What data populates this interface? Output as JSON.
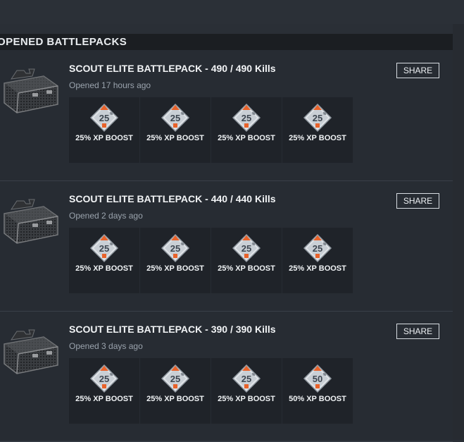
{
  "panel": {
    "title": "OPENED BATTLEPACKS"
  },
  "colors": {
    "background": "#2a2f36",
    "panel": "#272c33",
    "header_bar": "#1b1e22",
    "reward_tile": "#1f2329",
    "badge_orange": "#e8622a",
    "text_muted": "#9aa3ad"
  },
  "battlepacks": [
    {
      "icon": "battlepack-case-icon",
      "title": "SCOUT ELITE BATTLEPACK - 490 / 490 Kills",
      "opened": "Opened 17 hours ago",
      "share_label": "SHARE",
      "rewards": [
        {
          "icon": "xp-boost-icon",
          "badge_text": "25",
          "label": "25% XP BOOST"
        },
        {
          "icon": "xp-boost-icon",
          "badge_text": "25",
          "label": "25% XP BOOST"
        },
        {
          "icon": "xp-boost-icon",
          "badge_text": "25",
          "label": "25% XP BOOST"
        },
        {
          "icon": "xp-boost-icon",
          "badge_text": "25",
          "label": "25% XP BOOST"
        }
      ]
    },
    {
      "icon": "battlepack-case-icon",
      "title": "SCOUT ELITE BATTLEPACK - 440 / 440 Kills",
      "opened": "Opened 2 days ago",
      "share_label": "SHARE",
      "rewards": [
        {
          "icon": "xp-boost-icon",
          "badge_text": "25",
          "label": "25% XP BOOST"
        },
        {
          "icon": "xp-boost-icon",
          "badge_text": "25",
          "label": "25% XP BOOST"
        },
        {
          "icon": "xp-boost-icon",
          "badge_text": "25",
          "label": "25% XP BOOST"
        },
        {
          "icon": "xp-boost-icon",
          "badge_text": "25",
          "label": "25% XP BOOST"
        }
      ]
    },
    {
      "icon": "battlepack-case-icon",
      "title": "SCOUT ELITE BATTLEPACK - 390 / 390 Kills",
      "opened": "Opened 3 days ago",
      "share_label": "SHARE",
      "rewards": [
        {
          "icon": "xp-boost-icon",
          "badge_text": "25",
          "label": "25% XP BOOST"
        },
        {
          "icon": "xp-boost-icon",
          "badge_text": "25",
          "label": "25% XP BOOST"
        },
        {
          "icon": "xp-boost-icon",
          "badge_text": "25",
          "label": "25% XP BOOST"
        },
        {
          "icon": "xp-boost-icon",
          "badge_text": "50",
          "label": "50% XP BOOST"
        }
      ]
    }
  ]
}
